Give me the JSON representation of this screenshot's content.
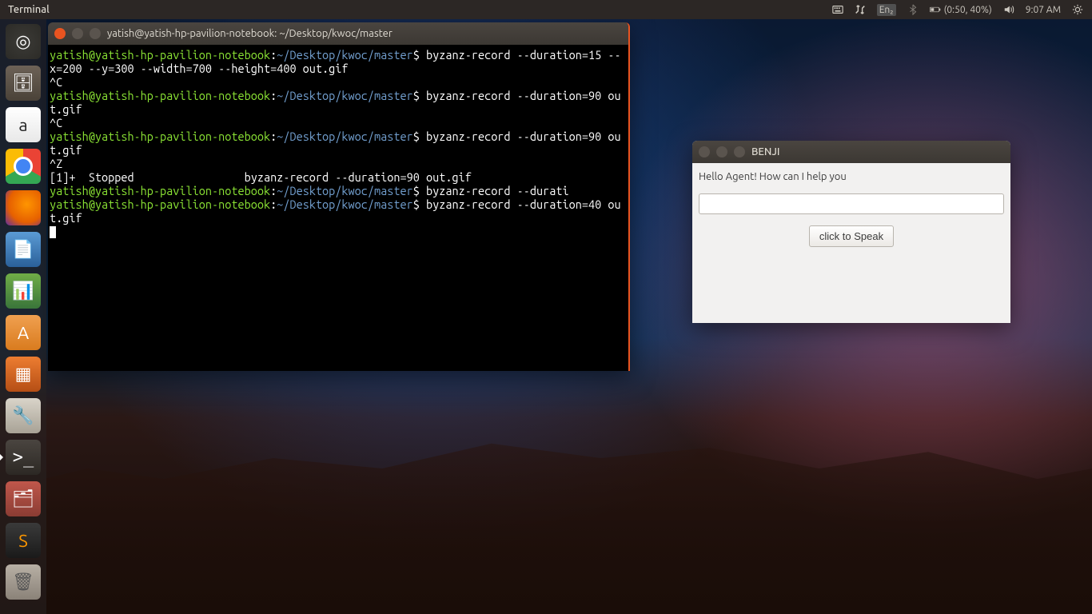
{
  "menubar": {
    "active_app": "Terminal",
    "keyboard": "En₂",
    "battery": "(0:50, 40%)",
    "time": "9:07 AM"
  },
  "launcher": {
    "items": [
      {
        "name": "dash-search",
        "glyph": "◎",
        "cls": "ico-search"
      },
      {
        "name": "files",
        "glyph": "🗄",
        "cls": "ico-files"
      },
      {
        "name": "amazon",
        "glyph": "a",
        "cls": "ico-amazon"
      },
      {
        "name": "chrome",
        "glyph": "",
        "cls": "ico-chrome"
      },
      {
        "name": "firefox",
        "glyph": "",
        "cls": "ico-firefox"
      },
      {
        "name": "libreoffice-writer",
        "glyph": "📄",
        "cls": "ico-writer"
      },
      {
        "name": "libreoffice-calc",
        "glyph": "📊",
        "cls": "ico-calc"
      },
      {
        "name": "ubuntu-software",
        "glyph": "A",
        "cls": "ico-software"
      },
      {
        "name": "libreoffice-impress",
        "glyph": "▦",
        "cls": "ico-impress"
      },
      {
        "name": "system-settings",
        "glyph": "🔧",
        "cls": "ico-settings"
      },
      {
        "name": "terminal",
        "glyph": ">_",
        "cls": "ico-terminal",
        "running": true
      },
      {
        "name": "files-open",
        "glyph": "🗂",
        "cls": "ico-files2"
      },
      {
        "name": "sublime-text",
        "glyph": "S",
        "cls": "ico-sublime"
      },
      {
        "name": "trash",
        "glyph": "🗑",
        "cls": "ico-trash"
      }
    ]
  },
  "terminal": {
    "title": "yatish@yatish-hp-pavilion-notebook: ~/Desktop/kwoc/master",
    "prompt_user_host": "yatish@yatish-hp-pavilion-notebook",
    "prompt_path": "~/Desktop/kwoc/master",
    "lines": [
      {
        "type": "cmd",
        "text": "byzanz-record --duration=15 --x=200 --y=300 --width=700 --height=400 out.gif"
      },
      {
        "type": "out",
        "text": "^C"
      },
      {
        "type": "cmd",
        "text": "byzanz-record --duration=90 out.gif"
      },
      {
        "type": "out",
        "text": "^C"
      },
      {
        "type": "cmd",
        "text": "byzanz-record --duration=90 out.gif"
      },
      {
        "type": "out",
        "text": "^Z"
      },
      {
        "type": "out",
        "text": "[1]+  Stopped                 byzanz-record --duration=90 out.gif"
      },
      {
        "type": "cmd",
        "text": "byzanz-record --durati"
      },
      {
        "type": "cmd",
        "text": "byzanz-record --duration=40 out.gif"
      }
    ]
  },
  "benji": {
    "title": "BENJI",
    "greeting": "Hello Agent! How can I help you",
    "input_value": "",
    "speak_button": "click to Speak"
  }
}
